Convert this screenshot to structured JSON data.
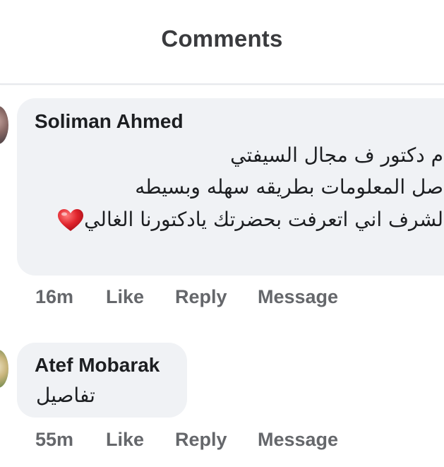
{
  "header": {
    "title": "Comments"
  },
  "comments": [
    {
      "author": "Soliman Ahmed",
      "lines": [
        "م دكتور ف مجال السيفتي",
        "صل المعلومات بطريقه سهله وبسيطه",
        "لشرف اني اتعرفت بحضرتك يادكتورنا الغالي"
      ],
      "emoji": "heart-icon",
      "time": "16m",
      "like_label": "Like",
      "reply_label": "Reply",
      "message_label": "Message"
    },
    {
      "author": "Atef Mobarak",
      "lines": [
        "تفاصيل"
      ],
      "time": "55m",
      "like_label": "Like",
      "reply_label": "Reply",
      "message_label": "Message"
    }
  ],
  "colors": {
    "bubble": "#f0f2f5",
    "author": "#1c1e21",
    "actions": "#65676b",
    "heart": "#e0242c"
  }
}
